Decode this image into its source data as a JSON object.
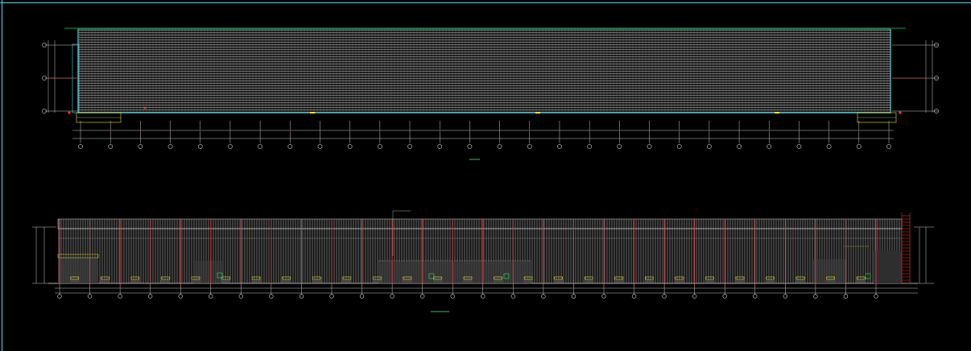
{
  "drawing": {
    "background": "#000000",
    "frame_color": "#5fd3dd",
    "plan": {
      "caption": "",
      "grid_axes": 28,
      "row_tags": [
        "",
        "",
        ""
      ]
    },
    "elevation": {
      "caption": "",
      "note": "",
      "grid_axes": 28
    },
    "colors": {
      "grid_line": "#e23a3a",
      "panel": "#d8d8d8",
      "accent_green": "#22d04a",
      "accent_yellow": "#f2e23a",
      "cyan": "#5fd3dd",
      "red_mark": "#ff3333"
    }
  }
}
